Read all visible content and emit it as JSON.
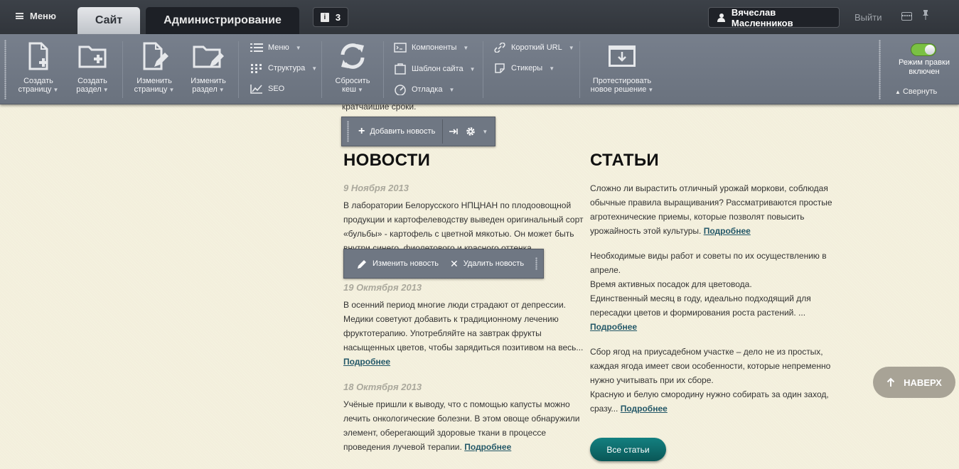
{
  "topbar": {
    "menu_label": "Меню",
    "tab_site": "Сайт",
    "tab_admin": "Администрирование",
    "notifications_count": "3",
    "user_name": "Вячеслав Масленников",
    "logout_label": "Выйти"
  },
  "toolbar": {
    "create_page": [
      "Создать",
      "страницу"
    ],
    "create_section": [
      "Создать",
      "раздел"
    ],
    "edit_page": [
      "Изменить",
      "страницу"
    ],
    "edit_section": [
      "Изменить",
      "раздел"
    ],
    "menu": "Меню",
    "structure": "Структура",
    "seo": "SEO",
    "reset_cache": [
      "Сбросить",
      "кеш"
    ],
    "components": "Компоненты",
    "site_template": "Шаблон сайта",
    "debug": "Отладка",
    "short_url": "Короткий URL",
    "stickers": "Стикеры",
    "test_solution": [
      "Протестировать",
      "новое решение"
    ],
    "edit_mode": [
      "Режим правки",
      "включен"
    ],
    "edit_mode_on": true,
    "collapse": "Свернуть"
  },
  "content": {
    "cut_text": "кратчайшие сроки.",
    "add_news": "Добавить новость",
    "edit_news": "Изменить новость",
    "delete_news": "Удалить новость",
    "news_title": "НОВОСТИ",
    "articles_title": "СТАТЬИ",
    "more_label": "Подробнее",
    "news": [
      {
        "date": "9 Ноября 2013",
        "text": "В лаборатории Белорусского НПЦНАН по плодоовощной продукции и картофелеводству выведен оригинальный сорт «бульбы» - картофель с цветной мякотью. Он может быть внутри синего, фиолетового и красного оттенка."
      },
      {
        "date": "19 Октября 2013",
        "text": "В осенний период многие люди страдают от депрессии. Медики советуют добавить к традиционному лечению фруктотерапию. Употребляйте на завтрак фрукты насыщенных цветов, чтобы зарядиться позитивом на весь..."
      },
      {
        "date": "18 Октября 2013",
        "text": "Учёные пришли к выводу, что с помощью капусты можно лечить онкологические болезни. В этом овоще обнаружили элемент, оберегающий здоровые ткани в процессе проведения лучевой терапии."
      }
    ],
    "articles": [
      {
        "text": "Сложно ли вырастить отличный урожай моркови, соблюдая обычные правила выращивания? Рассматриваются простые агротехнические приемы, которые позволят повысить урожайность этой культуры."
      },
      {
        "text": "Необходимые виды работ и советы по их осуществлению в апреле.\nВремя активных посадок для цветовода.\nЕдинственный месяц в году, идеально подходящий для пересадки цветов и формирования роста растений. ..."
      },
      {
        "text": "Сбор ягод на приусадебном участке – дело не из простых, каждая ягода имеет свои особенности, которые непременно нужно учитывать при их сборе.\nКрасную и белую смородину нужно собирать за один заход, сразу..."
      }
    ],
    "all_articles": "Все статьи",
    "to_top": "НАВЕРХ"
  }
}
